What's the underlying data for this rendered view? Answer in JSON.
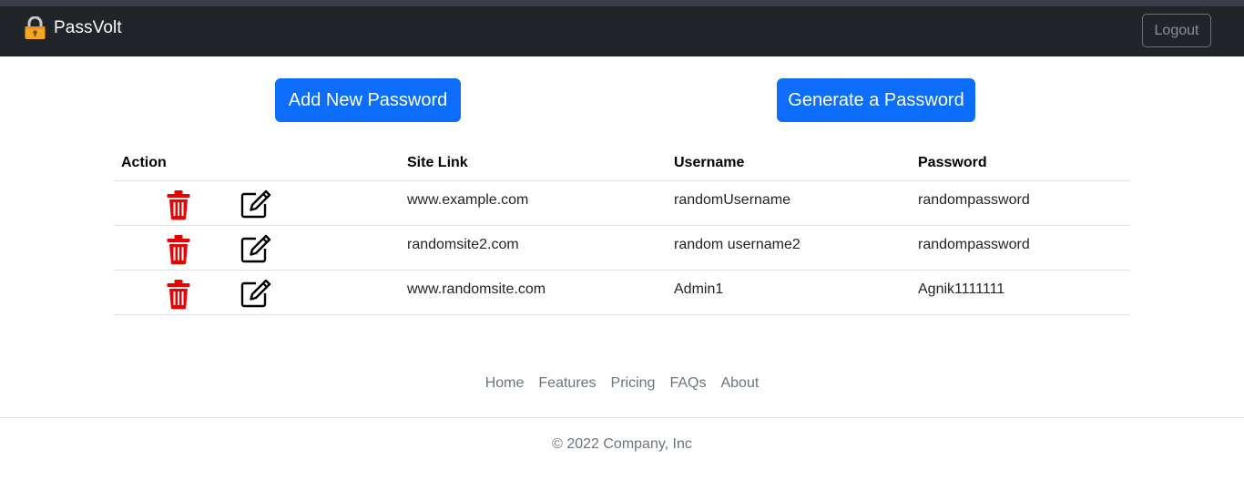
{
  "navbar": {
    "brand": "PassVolt",
    "brand_icon": "lock-icon",
    "logout_label": "Logout"
  },
  "actions": {
    "add_label": "Add New Password",
    "generate_label": "Generate a Password"
  },
  "table": {
    "headers": {
      "action": "Action",
      "site": "Site Link",
      "username": "Username",
      "password": "Password"
    },
    "rows": [
      {
        "site": "www.example.com",
        "username": "randomUsername",
        "password": "randompassword"
      },
      {
        "site": "randomsite2.com",
        "username": "random username2",
        "password": "randompassword"
      },
      {
        "site": "www.randomsite.com",
        "username": "Admin1",
        "password": "Agnik1111111"
      }
    ],
    "row_icons": [
      "trash-icon",
      "edit-icon"
    ]
  },
  "footer": {
    "links": [
      "Home",
      "Features",
      "Pricing",
      "FAQs",
      "About"
    ],
    "copyright": "© 2022 Company, Inc"
  },
  "colors": {
    "navbar": "#212529",
    "primary": "#0d6efd",
    "delete": "#ee0000",
    "lock": "#f5a623"
  }
}
